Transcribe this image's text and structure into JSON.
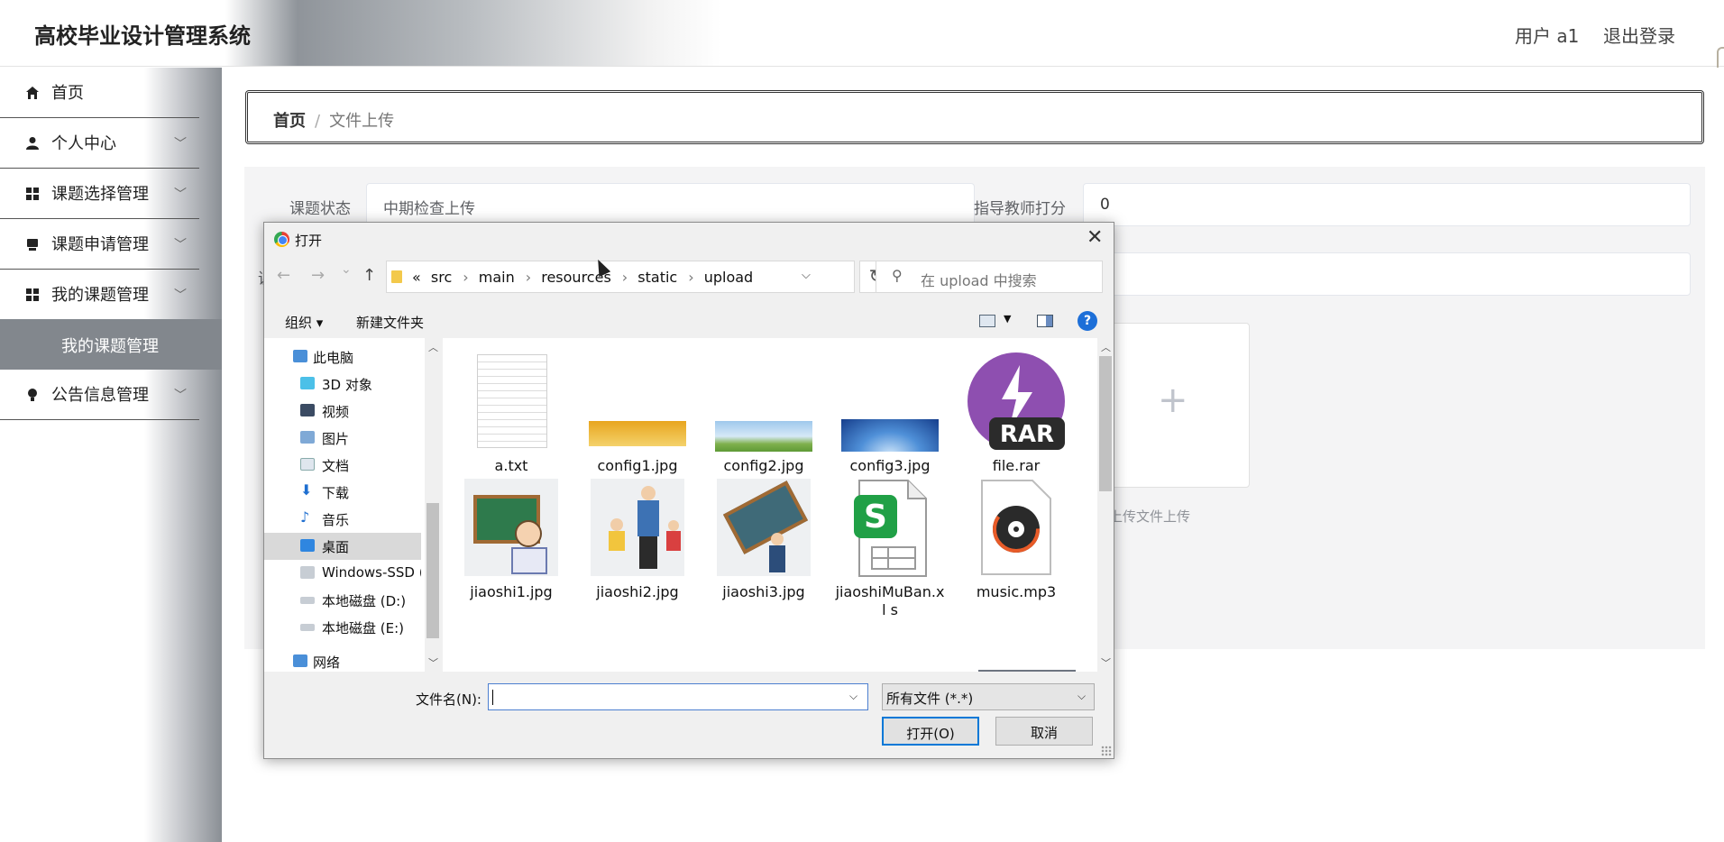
{
  "app": {
    "title": "高校毕业设计管理系统",
    "user": "用户 a1",
    "logout": "退出登录"
  },
  "sidebar": {
    "items": [
      {
        "label": "首页",
        "icon": "home-icon"
      },
      {
        "label": "个人中心",
        "icon": "user-icon"
      },
      {
        "label": "课题选择管理",
        "icon": "grid-icon"
      },
      {
        "label": "课题申请管理",
        "icon": "inbox-icon"
      },
      {
        "label": "我的课题管理",
        "icon": "grid-icon"
      },
      {
        "label": "公告信息管理",
        "icon": "bulb-icon"
      }
    ],
    "active_sub": "我的课题管理"
  },
  "breadcrumb": {
    "home": "首页",
    "sep": "/",
    "current": "文件上传"
  },
  "form": {
    "status_label": "课题状态",
    "status_value": "中期检查上传",
    "score_label": "指导教师打分",
    "score_value": "0",
    "row2_label_fragment": "课",
    "upload_plus": "+",
    "upload_hint": "上传文件上传"
  },
  "dialog": {
    "title": "打开",
    "close": "✕",
    "nav": {
      "back": "←",
      "forward": "→",
      "down": "⌄",
      "up": "↑"
    },
    "path_prefix": "«",
    "path": [
      "src",
      "main",
      "resources",
      "static",
      "upload"
    ],
    "refresh": "↻",
    "search_placeholder": "在 upload 中搜索",
    "organize": "组织 ▾",
    "new_folder": "新建文件夹",
    "help": "?",
    "tree": [
      "此电脑",
      "3D 对象",
      "视频",
      "图片",
      "文档",
      "下载",
      "音乐",
      "桌面",
      "Windows-SSD (",
      "本地磁盘 (D:)",
      "本地磁盘 (E:)",
      "网络"
    ],
    "files": [
      "a.txt",
      "config1.jpg",
      "config2.jpg",
      "config3.jpg",
      "file.rar",
      "jiaoshi1.jpg",
      "jiaoshi2.jpg",
      "jiaoshi3.jpg",
      "jiaoshiMuBan.xl s",
      "music.mp3"
    ],
    "rar_text": "RAR",
    "filename_label": "文件名(N):",
    "filename_value": "",
    "filetype": "所有文件 (*.*)",
    "open": "打开(O)",
    "cancel": "取消"
  },
  "colors": {
    "accent": "#0078d7",
    "rar_purple": "#8e4fb0",
    "sidebar_active": "#82878d"
  }
}
